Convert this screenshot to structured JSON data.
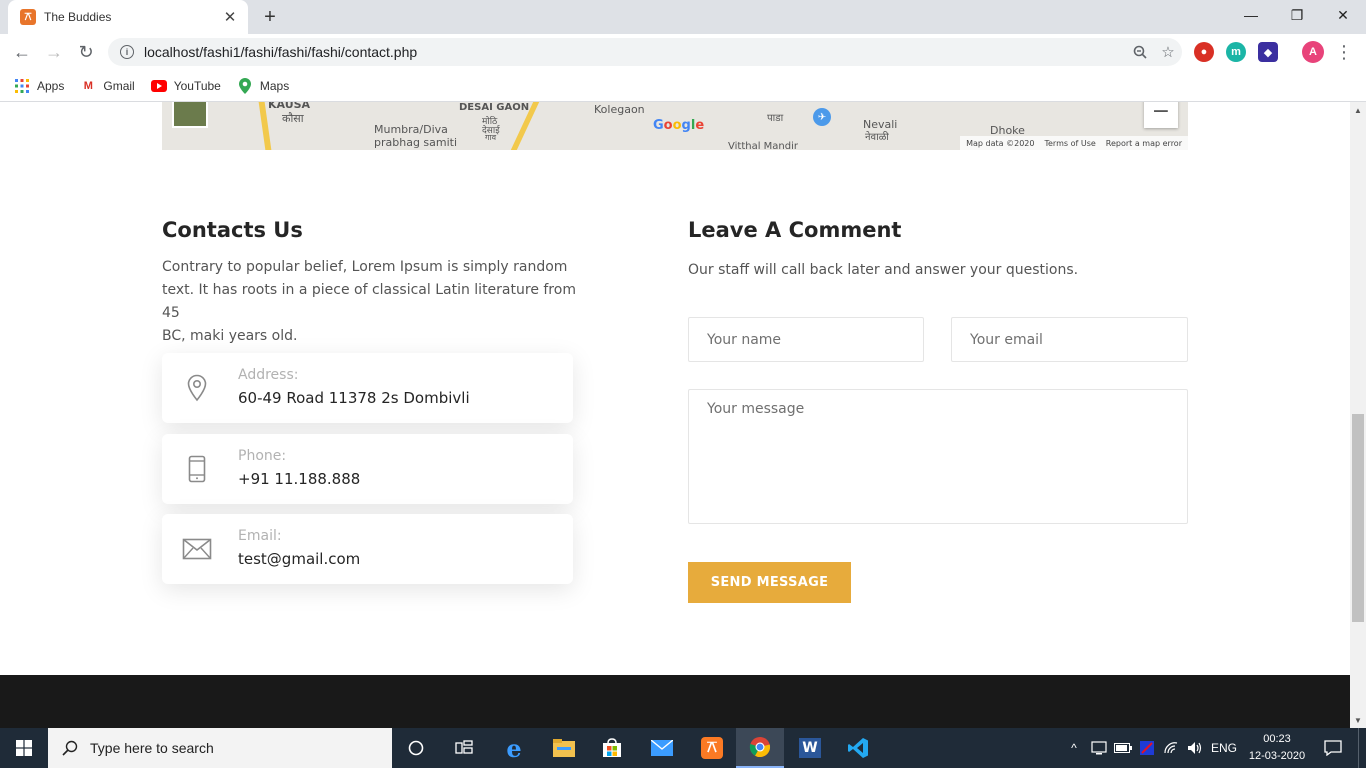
{
  "browser": {
    "tab_title": "The Buddies",
    "tab_favicon_glyph": "⚻",
    "url": "localhost/fashi1/fashi/fashi/fashi/contact.php",
    "profile_initial": "A",
    "ext_initial": "m"
  },
  "bookmarks": [
    {
      "label": "Apps",
      "icon": "apps-grid-icon"
    },
    {
      "label": "Gmail",
      "icon": "gmail-icon"
    },
    {
      "label": "YouTube",
      "icon": "youtube-icon"
    },
    {
      "label": "Maps",
      "icon": "maps-icon"
    }
  ],
  "map": {
    "labels": {
      "kausa": "KAUSA",
      "kausa_local": "कौसा",
      "desai_gaon": "DESAI GAON",
      "desai_local_1": "मोठि",
      "desai_local_2": "देसाई",
      "desai_local_3": "गाव",
      "mumbra": "Mumbra/Diva",
      "prabhag": "prabhag samiti",
      "kolegaon": "Kolegaon",
      "pada": "पाडा",
      "nevali": "Nevali",
      "nevali_local": "नेवाळी",
      "dhoke": "Dhoke",
      "vitthal": "Vitthal Mandir"
    },
    "google": "Google",
    "footer": {
      "data": "Map data ©2020",
      "terms": "Terms of Use",
      "report": "Report a map error"
    },
    "zoom_out": "−"
  },
  "contact": {
    "title": "Contacts Us",
    "description_lines": [
      "Contrary to popular belief, Lorem Ipsum is simply random",
      "text. It has roots in a piece of classical Latin literature from 45",
      "BC, maki years old."
    ],
    "cards": [
      {
        "label": "Address:",
        "value": "60-49 Road 11378 2s Dombivli",
        "icon": "location-pin-icon"
      },
      {
        "label": "Phone:",
        "value": "+91 11.188.888",
        "icon": "mobile-phone-icon"
      },
      {
        "label": "Email:",
        "value": "test@gmail.com",
        "icon": "envelope-icon"
      }
    ]
  },
  "comment": {
    "title": "Leave A Comment",
    "subtitle": "Our staff will call back later and answer your questions.",
    "name_placeholder": "Your name",
    "email_placeholder": "Your email",
    "message_placeholder": "Your message",
    "send_label": "SEND MESSAGE"
  },
  "taskbar": {
    "search_placeholder": "Type here to search",
    "language": "ENG",
    "time": "00:23",
    "date": "12-03-2020",
    "apps": [
      "cortana-icon",
      "task-view-icon",
      "edge-icon",
      "file-explorer-icon",
      "store-icon",
      "mail-icon",
      "xampp-icon",
      "chrome-icon",
      "word-icon",
      "vscode-icon"
    ]
  },
  "colors": {
    "accent": "#e7ab3c",
    "footer": "#191919",
    "taskbar": "#1f2b38"
  }
}
